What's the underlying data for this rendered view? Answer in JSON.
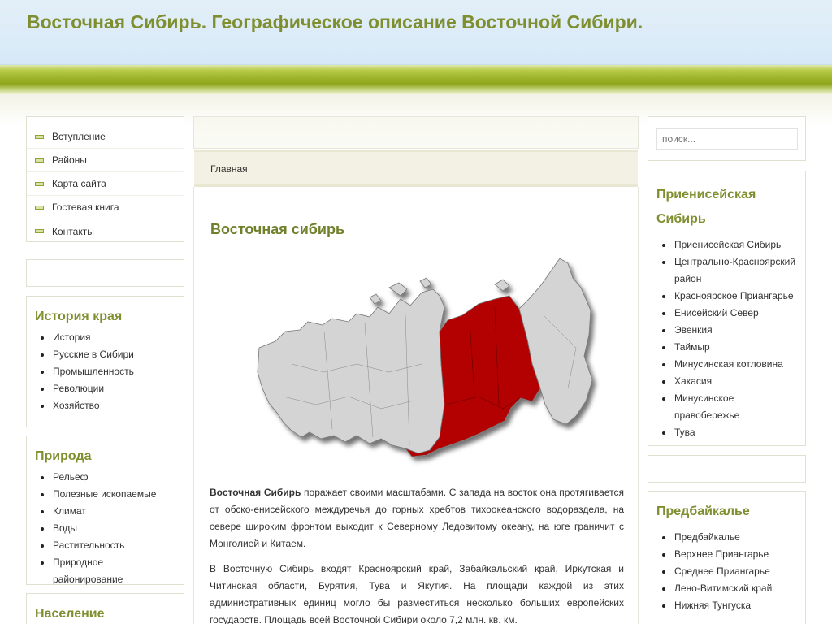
{
  "header": {
    "title": "Восточная Сибирь. Географическое описание Восточной Сибири."
  },
  "topmenu": [
    "Вступление",
    "Районы",
    "Карта сайта",
    "Гостевая книга",
    "Контакты"
  ],
  "history": {
    "title": "История края",
    "items": [
      "История",
      "Русские в Сибири",
      "Промышленность",
      "Революции",
      "Хозяйство"
    ]
  },
  "nature": {
    "title": "Природа",
    "items": [
      "Рельеф",
      "Полезные ископаемые",
      "Климат",
      "Воды",
      "Растительность",
      "Природное районирование"
    ]
  },
  "people": {
    "title": "Население"
  },
  "breadcrumb": "Главная",
  "article": {
    "title": "Восточная сибирь",
    "p1_bold": "Восточная Сибирь",
    "p1_rest": " поражает своими масштабами. С запада на восток она протягивается от обско-енисейского междуречья до горных хребтов тихоокеанского водораздела, на севере широким фронтом выходит к Северному Ледовитому океану, на юге граничит с Монголией и Китаем.",
    "p2": "В Восточную Сибирь входят Красноярский край, Забайкальский край, Иркутская и Читинская области, Бурятия, Тува и Якутия. На площади каждой из этих административных единиц могло бы разместиться несколько больших европейских государств. Площадь всей Восточной Сибири около 7,2 млн. кв. км."
  },
  "search": {
    "placeholder": "поиск..."
  },
  "prienisey": {
    "title": "Приенисейская Сибирь",
    "items": [
      "Приенисейская Сибирь",
      "Центрально-Красноярский район",
      "Красноярское Приангарье",
      "Енисейский Север",
      "Эвенкия",
      "Таймыр",
      "Минусинская котловина",
      "Хакасия",
      "Минусинское правобережье",
      "Тува"
    ]
  },
  "predbaikal": {
    "title": "Предбайкалье",
    "items": [
      "Предбайкалье",
      "Верхнее Приангарье",
      "Среднее Приангарье",
      "Лено-Витимский край",
      "Нижняя Тунгуска"
    ]
  },
  "colors": {
    "accent": "#7f8f2f",
    "map_highlight": "#b30000",
    "map_base": "#d4d4d4"
  }
}
